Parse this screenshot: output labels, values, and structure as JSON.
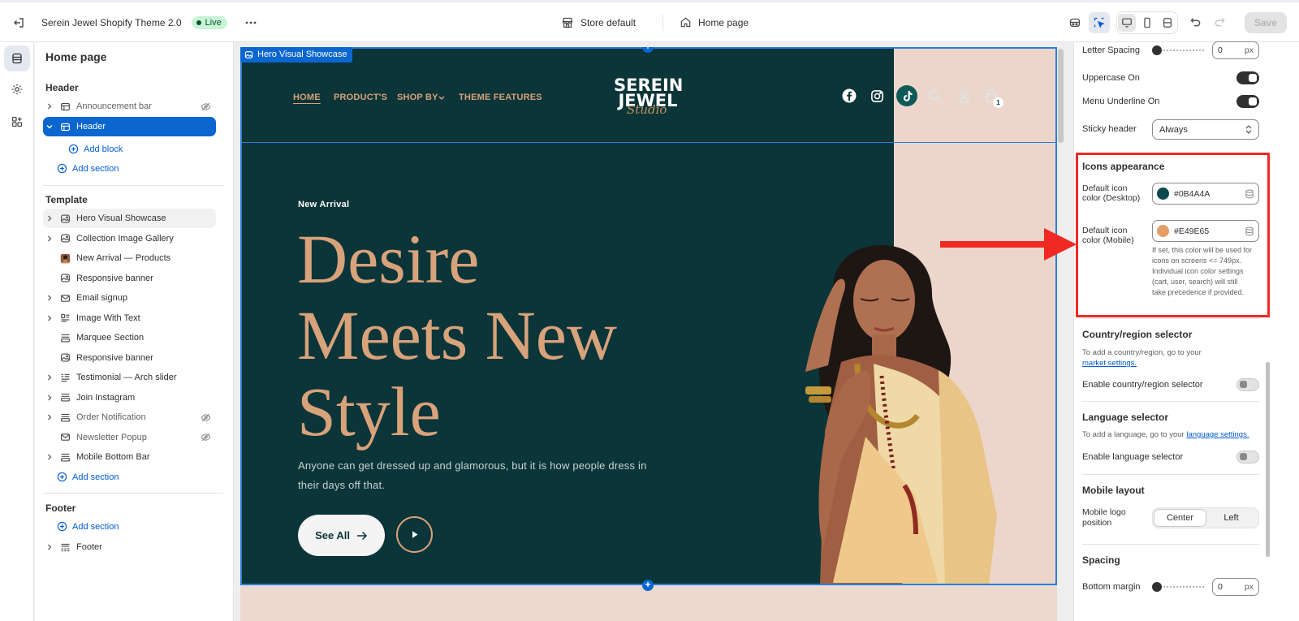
{
  "topbar": {
    "theme_name": "Serein Jewel Shopify Theme 2.0",
    "status": "Live",
    "store": "Store default",
    "page": "Home page",
    "save": "Save"
  },
  "sidebar": {
    "title": "Home page",
    "header_group": "Header",
    "header_items": [
      {
        "label": "Announcement bar",
        "hidden": true
      },
      {
        "label": "Header",
        "selected": true
      }
    ],
    "add_block": "Add block",
    "add_section": "Add section",
    "template_group": "Template",
    "template_items": [
      {
        "label": "Hero Visual Showcase"
      },
      {
        "label": "Collection Image Gallery"
      },
      {
        "label": "New Arrival — Products"
      },
      {
        "label": "Responsive banner"
      },
      {
        "label": "Email signup"
      },
      {
        "label": "Image With Text"
      },
      {
        "label": "Marquee Section"
      },
      {
        "label": "Responsive banner"
      },
      {
        "label": "Testimonial — Arch slider"
      },
      {
        "label": "Join Instagram"
      },
      {
        "label": "Order Notification",
        "hidden": true
      },
      {
        "label": "Newsletter Popup",
        "hidden": true
      },
      {
        "label": "Mobile Bottom Bar"
      }
    ],
    "footer_group": "Footer",
    "footer_items": [
      {
        "label": "Footer"
      }
    ]
  },
  "preview": {
    "section_tag": "Hero Visual Showcase",
    "nav": [
      "HOME",
      "PRODUCT'S",
      "SHOP BY",
      "THEME FEATURES"
    ],
    "logo_line1": "SEREIN",
    "logo_line2": "JEWEL",
    "logo_script": "Studio",
    "cart_count": "1",
    "kicker": "New Arrival",
    "title_lines": [
      "Desire",
      "Meets New",
      "Style"
    ],
    "text": "Anyone can get dressed up and glamorous, but it is how people dress in their days off that.",
    "cta": "See All",
    "colors": {
      "hero_bg": "#0B3538",
      "accent": "#D8A27B",
      "panel": "#ECD6CC"
    }
  },
  "settings": {
    "letter_spacing_label": "Letter Spacing",
    "letter_spacing_value": "0",
    "unit": "px",
    "uppercase_label": "Uppercase On",
    "menu_underline_label": "Menu Underline On",
    "sticky_label": "Sticky header",
    "sticky_value": "Always",
    "icons_head": "Icons appearance",
    "icon_desktop_label": "Default icon color (Desktop)",
    "icon_desktop_value": "#0B4A4A",
    "icon_mobile_label": "Default icon color (Mobile)",
    "icon_mobile_value": "#E49E65",
    "icon_mobile_help": "If set, this color will be used for icons on screens <= 749px. Individual icon color settings (cart, user, search) will still take precedence if provided.",
    "country_head": "Country/region selector",
    "country_help": "To add a country/region, go to your",
    "country_link": "market settings.",
    "country_toggle_label": "Enable country/region selector",
    "language_head": "Language selector",
    "language_help": "To add a language, go to your",
    "language_link": "language settings.",
    "language_toggle_label": "Enable language selector",
    "mobile_head": "Mobile layout",
    "mobile_logo_label": "Mobile logo position",
    "mobile_options": [
      "Center",
      "Left"
    ],
    "spacing_head": "Spacing",
    "bottom_margin_label": "Bottom margin",
    "bottom_margin_value": "0"
  }
}
